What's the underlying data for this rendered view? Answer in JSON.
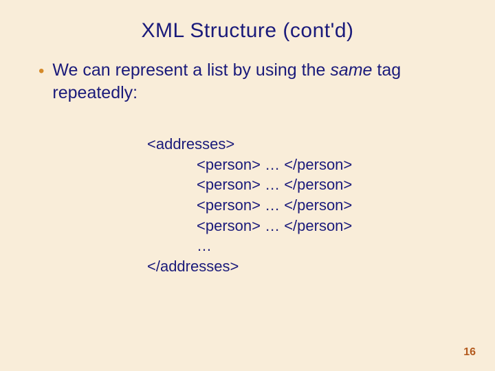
{
  "title": "XML Structure (cont'd)",
  "bullet": {
    "pre": "We can represent a list by using the ",
    "emph": "same",
    "post": " tag repeatedly:"
  },
  "code": {
    "open": "<addresses>",
    "lines": [
      "<person> … </person>",
      "<person> … </person>",
      "<person> … </person>",
      "<person> … </person>",
      "…"
    ],
    "close": "</addresses>"
  },
  "page": "16"
}
